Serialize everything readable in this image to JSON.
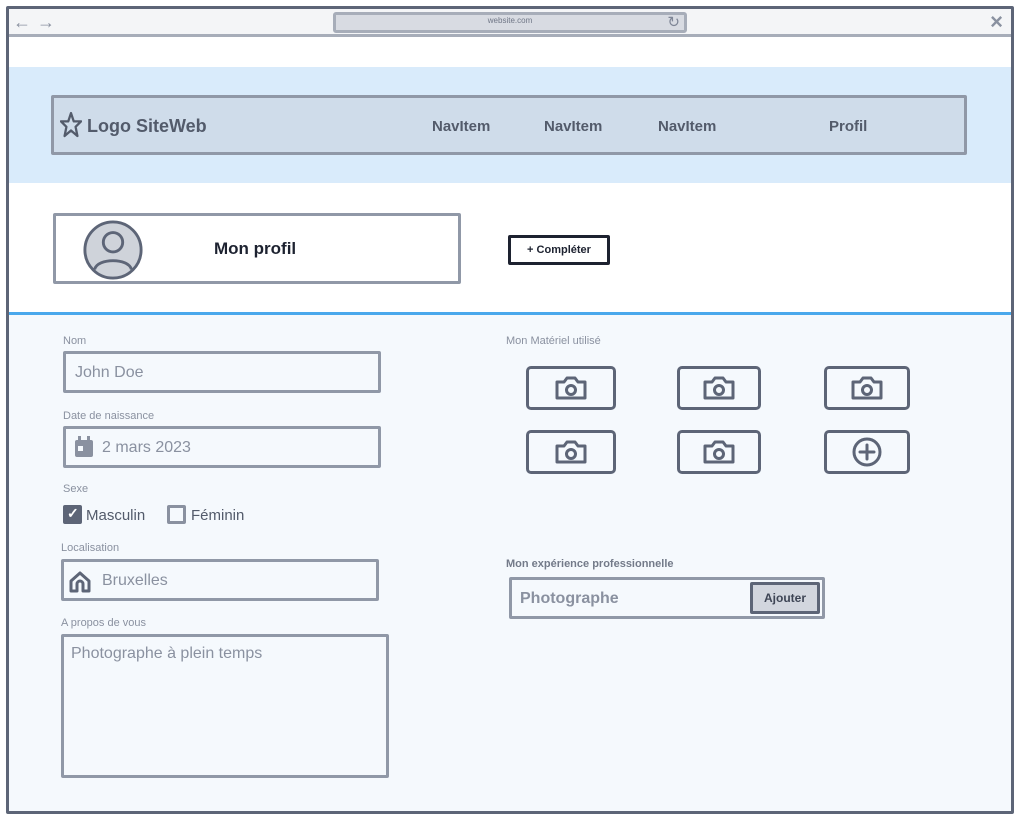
{
  "browser": {
    "url": "website.com"
  },
  "header": {
    "logo": "Logo SiteWeb",
    "nav_items": [
      "NavItem",
      "NavItem",
      "NavItem"
    ],
    "profile_link": "Profil"
  },
  "profile": {
    "title": "Mon profil",
    "complete_button": "+ Compléter"
  },
  "form": {
    "name_label": "Nom",
    "name_value": "John Doe",
    "birthdate_label": "Date de naissance",
    "birthdate_value": "2 mars 2023",
    "sex_label": "Sexe",
    "sex_options": [
      {
        "label": "Masculin",
        "checked": true
      },
      {
        "label": "Féminin",
        "checked": false
      }
    ],
    "location_label": "Localisation",
    "location_value": "Bruxelles",
    "about_label": "A propos de vous",
    "about_value": "Photographe à plein temps"
  },
  "equipment": {
    "label": "Mon Matériel utilisé",
    "tiles": [
      "camera-icon",
      "camera-icon",
      "camera-icon",
      "camera-icon",
      "camera-icon",
      "plus-circle-icon"
    ]
  },
  "experience": {
    "label": "Mon expérience professionnelle",
    "value": "Photographe",
    "add_button": "Ajouter"
  },
  "colors": {
    "accent": "#4aa8ec",
    "header_band": "#d9ebfb",
    "navbar": "#cfdcea",
    "outline": "#5d6577"
  }
}
